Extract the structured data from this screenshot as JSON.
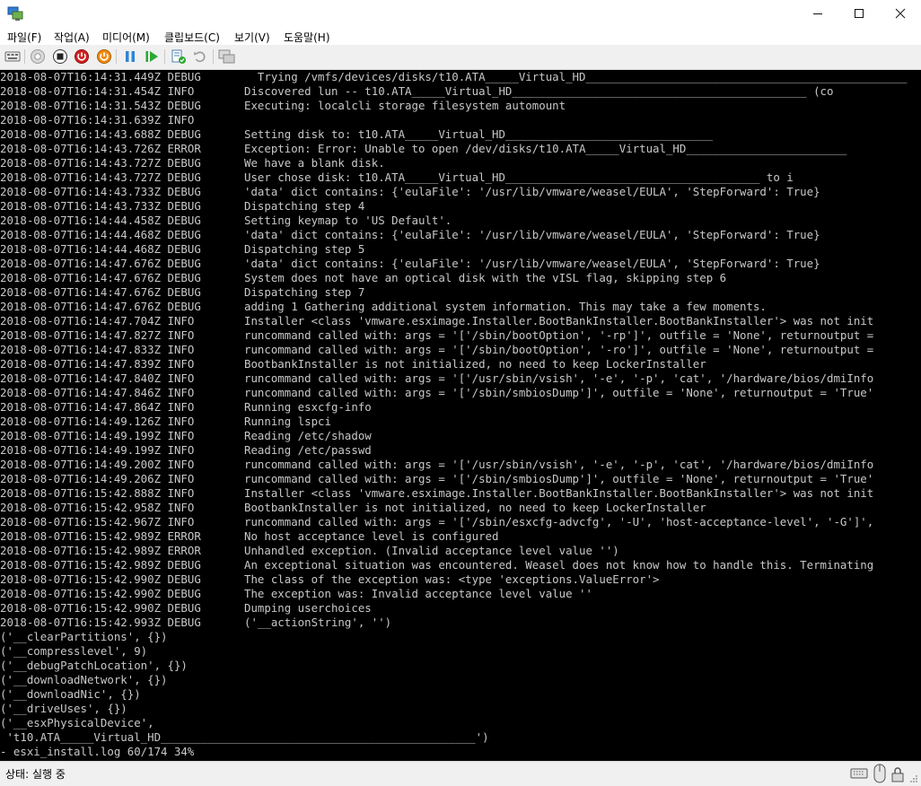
{
  "menu": [
    {
      "name": "menu-file",
      "label": "파일(F)"
    },
    {
      "name": "menu-action",
      "label": "작업(A)"
    },
    {
      "name": "menu-media",
      "label": "미디어(M)"
    },
    {
      "name": "menu-clipboard",
      "label": "클립보드(C)"
    },
    {
      "name": "menu-view",
      "label": "보기(V)"
    },
    {
      "name": "menu-help",
      "label": "도움말(H)"
    }
  ],
  "toolbar": {
    "icons": [
      "ctrl-alt-del-icon",
      "start-icon",
      "turn-off-icon",
      "shut-down-icon",
      "power-icon",
      "pause-icon",
      "resume-icon",
      "checkpoint-icon",
      "revert-icon",
      "enhanced-session-icon"
    ]
  },
  "log_lines": [
    {
      "ts": "2018-08-07T16:14:31.449Z DEBUG",
      "msg": "  Trying /vmfs/devices/disks/t10.ATA_____Virtual_HD________________________________________________"
    },
    {
      "ts": "2018-08-07T16:14:31.454Z INFO",
      "msg": "Discovered lun -- t10.ATA_____Virtual_HD____________________________________________ (co"
    },
    {
      "ts": "2018-08-07T16:14:31.543Z DEBUG",
      "msg": "Executing: localcli storage filesystem automount"
    },
    {
      "ts": "2018-08-07T16:14:31.639Z INFO",
      "msg": ""
    },
    {
      "ts": "2018-08-07T16:14:43.688Z DEBUG",
      "msg": "Setting disk to: t10.ATA_____Virtual_HD_______________________________"
    },
    {
      "ts": "2018-08-07T16:14:43.726Z ERROR",
      "msg": "Exception: Error: Unable to open /dev/disks/t10.ATA_____Virtual_HD________________________"
    },
    {
      "ts": "2018-08-07T16:14:43.727Z DEBUG",
      "msg": "We have a blank disk."
    },
    {
      "ts": "2018-08-07T16:14:43.727Z DEBUG",
      "msg": "User chose disk: t10.ATA_____Virtual_HD______________________________________ to i"
    },
    {
      "ts": "2018-08-07T16:14:43.733Z DEBUG",
      "msg": "'data' dict contains: {'eulaFile': '/usr/lib/vmware/weasel/EULA', 'StepForward': True}"
    },
    {
      "ts": "2018-08-07T16:14:43.733Z DEBUG",
      "msg": "Dispatching step 4"
    },
    {
      "ts": "2018-08-07T16:14:44.458Z DEBUG",
      "msg": "Setting keymap to 'US Default'."
    },
    {
      "ts": "2018-08-07T16:14:44.468Z DEBUG",
      "msg": "'data' dict contains: {'eulaFile': '/usr/lib/vmware/weasel/EULA', 'StepForward': True}"
    },
    {
      "ts": "2018-08-07T16:14:44.468Z DEBUG",
      "msg": "Dispatching step 5"
    },
    {
      "ts": "2018-08-07T16:14:47.676Z DEBUG",
      "msg": "'data' dict contains: {'eulaFile': '/usr/lib/vmware/weasel/EULA', 'StepForward': True}"
    },
    {
      "ts": "2018-08-07T16:14:47.676Z DEBUG",
      "msg": "System does not have an optical disk with the vISL flag, skipping step 6"
    },
    {
      "ts": "2018-08-07T16:14:47.676Z DEBUG",
      "msg": "Dispatching step 7"
    },
    {
      "ts": "2018-08-07T16:14:47.676Z DEBUG",
      "msg": "adding 1 Gathering additional system information. This may take a few moments."
    },
    {
      "ts": "2018-08-07T16:14:47.704Z INFO",
      "msg": "Installer <class 'vmware.esximage.Installer.BootBankInstaller.BootBankInstaller'> was not init"
    },
    {
      "ts": "2018-08-07T16:14:47.827Z INFO",
      "msg": "runcommand called with: args = '['/sbin/bootOption', '-rp']', outfile = 'None', returnoutput ="
    },
    {
      "ts": "2018-08-07T16:14:47.833Z INFO",
      "msg": "runcommand called with: args = '['/sbin/bootOption', '-ro']', outfile = 'None', returnoutput ="
    },
    {
      "ts": "2018-08-07T16:14:47.839Z INFO",
      "msg": "BootbankInstaller is not initialized, no need to keep LockerInstaller"
    },
    {
      "ts": "2018-08-07T16:14:47.840Z INFO",
      "msg": "runcommand called with: args = '['/usr/sbin/vsish', '-e', '-p', 'cat', '/hardware/bios/dmiInfo"
    },
    {
      "ts": "2018-08-07T16:14:47.846Z INFO",
      "msg": "runcommand called with: args = '['/sbin/smbiosDump']', outfile = 'None', returnoutput = 'True'"
    },
    {
      "ts": "2018-08-07T16:14:47.864Z INFO",
      "msg": "Running esxcfg-info"
    },
    {
      "ts": "2018-08-07T16:14:49.126Z INFO",
      "msg": "Running lspci"
    },
    {
      "ts": "2018-08-07T16:14:49.199Z INFO",
      "msg": "Reading /etc/shadow"
    },
    {
      "ts": "2018-08-07T16:14:49.199Z INFO",
      "msg": "Reading /etc/passwd"
    },
    {
      "ts": "2018-08-07T16:14:49.200Z INFO",
      "msg": "runcommand called with: args = '['/usr/sbin/vsish', '-e', '-p', 'cat', '/hardware/bios/dmiInfo"
    },
    {
      "ts": "2018-08-07T16:14:49.206Z INFO",
      "msg": "runcommand called with: args = '['/sbin/smbiosDump']', outfile = 'None', returnoutput = 'True'"
    },
    {
      "ts": "2018-08-07T16:15:42.888Z INFO",
      "msg": "Installer <class 'vmware.esximage.Installer.BootBankInstaller.BootBankInstaller'> was not init"
    },
    {
      "ts": "2018-08-07T16:15:42.958Z INFO",
      "msg": "BootbankInstaller is not initialized, no need to keep LockerInstaller"
    },
    {
      "ts": "2018-08-07T16:15:42.967Z INFO",
      "msg": "runcommand called with: args = '['/sbin/esxcfg-advcfg', '-U', 'host-acceptance-level', '-G']',"
    },
    {
      "ts": "2018-08-07T16:15:42.989Z ERROR",
      "msg": "No host acceptance level is configured"
    },
    {
      "ts": "2018-08-07T16:15:42.989Z ERROR",
      "msg": "Unhandled exception. (Invalid acceptance level value '')"
    },
    {
      "ts": "2018-08-07T16:15:42.989Z DEBUG",
      "msg": "An exceptional situation was encountered. Weasel does not know how to handle this. Terminating"
    },
    {
      "ts": "2018-08-07T16:15:42.990Z DEBUG",
      "msg": "The class of the exception was: <type 'exceptions.ValueError'>"
    },
    {
      "ts": "2018-08-07T16:15:42.990Z DEBUG",
      "msg": "The exception was: Invalid acceptance level value ''"
    },
    {
      "ts": "2018-08-07T16:15:42.990Z DEBUG",
      "msg": "Dumping userchoices"
    },
    {
      "ts": "2018-08-07T16:15:42.993Z DEBUG",
      "msg": "('__actionString', '')"
    },
    {
      "ts": "",
      "msg": "('__clearPartitions', {})"
    },
    {
      "ts": "",
      "msg": "('__compresslevel', 9)"
    },
    {
      "ts": "",
      "msg": "('__debugPatchLocation', {})"
    },
    {
      "ts": "",
      "msg": "('__downloadNetwork', {})"
    },
    {
      "ts": "",
      "msg": "('__downloadNic', {})"
    },
    {
      "ts": "",
      "msg": "('__driveUses', {})"
    },
    {
      "ts": "",
      "msg": "('__esxPhysicalDevice',"
    },
    {
      "ts": "",
      "msg": " 't10.ATA_____Virtual_HD_______________________________________________')"
    },
    {
      "ts": "",
      "msg": "- esxi_install.log 60/174 34%"
    }
  ],
  "status": {
    "text": "상태: 실행 중"
  },
  "colors": {
    "console_bg": "#000000",
    "console_fg": "#c8c8c8",
    "toolbar_bg": "#f0f0f0"
  }
}
